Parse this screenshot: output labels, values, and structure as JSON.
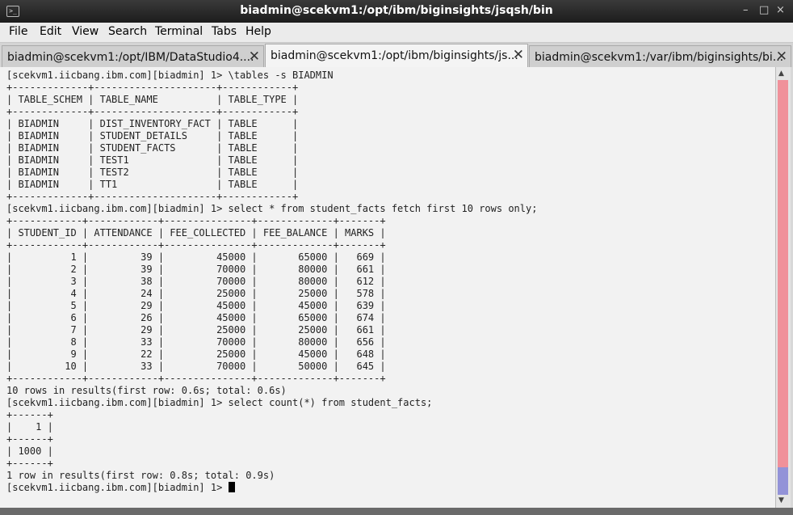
{
  "window": {
    "title": "biadmin@scekvm1:/opt/ibm/biginsights/jsqsh/bin",
    "app_icon_glyph": ">_",
    "minimize_glyph": "–",
    "maximize_glyph": "□",
    "close_glyph": "×"
  },
  "menu": [
    "File",
    "Edit",
    "View",
    "Search",
    "Terminal",
    "Tabs",
    "Help"
  ],
  "tabs": [
    {
      "label": "biadmin@scekvm1:/opt/IBM/DataStudio4....",
      "close_glyph": "✕",
      "active": false
    },
    {
      "label": "biadmin@scekvm1:/opt/ibm/biginsights/js...",
      "close_glyph": "✕",
      "active": true
    },
    {
      "label": "biadmin@scekvm1:/var/ibm/biginsights/bi...",
      "close_glyph": "✕",
      "active": false
    }
  ],
  "terminal": {
    "lines": [
      "[scekvm1.iicbang.ibm.com][biadmin] 1> \\tables -s BIADMIN",
      "+-------------+---------------------+------------+",
      "| TABLE_SCHEM | TABLE_NAME          | TABLE_TYPE |",
      "+-------------+---------------------+------------+",
      "| BIADMIN     | DIST_INVENTORY_FACT | TABLE      |",
      "| BIADMIN     | STUDENT_DETAILS     | TABLE      |",
      "| BIADMIN     | STUDENT_FACTS       | TABLE      |",
      "| BIADMIN     | TEST1               | TABLE      |",
      "| BIADMIN     | TEST2               | TABLE      |",
      "| BIADMIN     | TT1                 | TABLE      |",
      "+-------------+---------------------+------------+",
      "[scekvm1.iicbang.ibm.com][biadmin] 1> select * from student_facts fetch first 10 rows only;",
      "+------------+------------+---------------+-------------+-------+",
      "| STUDENT_ID | ATTENDANCE | FEE_COLLECTED | FEE_BALANCE | MARKS |",
      "+------------+------------+---------------+-------------+-------+",
      "|          1 |         39 |         45000 |       65000 |   669 |",
      "|          2 |         39 |         70000 |       80000 |   661 |",
      "|          3 |         38 |         70000 |       80000 |   612 |",
      "|          4 |         24 |         25000 |       25000 |   578 |",
      "|          5 |         29 |         45000 |       45000 |   639 |",
      "|          6 |         26 |         45000 |       65000 |   674 |",
      "|          7 |         29 |         25000 |       25000 |   661 |",
      "|          8 |         33 |         70000 |       80000 |   656 |",
      "|          9 |         22 |         25000 |       45000 |   648 |",
      "|         10 |         33 |         70000 |       50000 |   645 |",
      "+------------+------------+---------------+-------------+-------+",
      "10 rows in results(first row: 0.6s; total: 0.6s)",
      "[scekvm1.iicbang.ibm.com][biadmin] 1> select count(*) from student_facts;",
      "+------+",
      "|    1 |",
      "+------+",
      "| 1000 |",
      "+------+",
      "1 row in results(first row: 0.8s; total: 0.9s)",
      "[scekvm1.iicbang.ibm.com][biadmin] 1> "
    ]
  },
  "colors": {
    "terminal_bg": "#f2f2f2",
    "terminal_fg": "#222222",
    "scroll_track": "#f0919a",
    "scroll_thumb": "#9393d8"
  }
}
